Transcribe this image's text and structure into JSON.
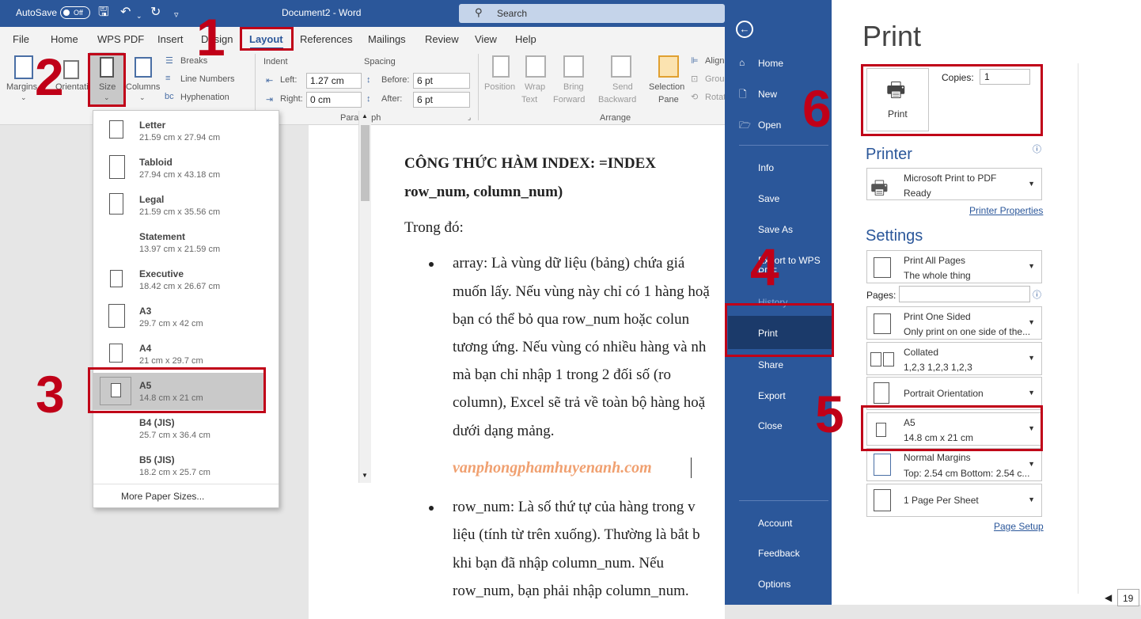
{
  "titlebar": {
    "autosave_label": "AutoSave",
    "autosave_state": "Off",
    "doc_title": "Document2 - Word",
    "search_placeholder": "Search"
  },
  "tabs": [
    "File",
    "Home",
    "WPS PDF",
    "Insert",
    "Design",
    "Layout",
    "References",
    "Mailings",
    "Review",
    "View",
    "Help"
  ],
  "ribbon": {
    "margins": "Margins",
    "orientation": "Orientation",
    "size": "Size",
    "columns": "Columns",
    "breaks": "Breaks",
    "line_numbers": "Line Numbers",
    "hyphenation": "Hyphenation",
    "indent_title": "Indent",
    "indent_left_label": "Left:",
    "indent_left_value": "1.27 cm",
    "indent_right_label": "Right:",
    "indent_right_value": "0 cm",
    "spacing_title": "Spacing",
    "spacing_before_label": "Before:",
    "spacing_before_value": "6 pt",
    "spacing_after_label": "After:",
    "spacing_after_value": "6 pt",
    "paragraph_group": "Paragraph",
    "position": "Position",
    "wrap_text_1": "Wrap",
    "wrap_text_2": "Text",
    "bring_forward_1": "Bring",
    "bring_forward_2": "Forward",
    "send_backward_1": "Send",
    "send_backward_2": "Backward",
    "selection_pane_1": "Selection",
    "selection_pane_2": "Pane",
    "align": "Align",
    "group": "Group",
    "rotate": "Rotate",
    "arrange_group": "Arrange"
  },
  "size_menu": {
    "items": [
      {
        "name": "Letter",
        "dims": "21.59 cm x 27.94 cm"
      },
      {
        "name": "Tabloid",
        "dims": "27.94 cm x 43.18 cm"
      },
      {
        "name": "Legal",
        "dims": "21.59 cm x 35.56 cm"
      },
      {
        "name": "Statement",
        "dims": "13.97 cm x 21.59 cm"
      },
      {
        "name": "Executive",
        "dims": "18.42 cm x 26.67 cm"
      },
      {
        "name": "A3",
        "dims": "29.7 cm x 42 cm"
      },
      {
        "name": "A4",
        "dims": "21 cm x 29.7 cm"
      },
      {
        "name": "A5",
        "dims": "14.8 cm x 21 cm"
      },
      {
        "name": "B4 (JIS)",
        "dims": "25.7 cm x 36.4 cm"
      },
      {
        "name": "B5 (JIS)",
        "dims": "18.2 cm x 25.7 cm"
      }
    ],
    "more": "More Paper Sizes..."
  },
  "document": {
    "heading_1": "CÔNG   THỨC   HÀM   INDEX:   =INDEX",
    "heading_2": "row_num, column_num)",
    "intro": "Trong đó:",
    "b1_l1": "array: Là vùng dữ liệu (bảng) chứa giá",
    "b1_l2": "muốn lấy. Nếu vùng này chỉ có 1 hàng hoặ",
    "b1_l3": "bạn có thể bỏ qua row_num hoặc colun",
    "b1_l4": "tương ứng. Nếu vùng có nhiều hàng và nh",
    "b1_l5": "mà bạn chỉ nhập 1 trong 2 đối số (ro",
    "b1_l6": "column), Excel sẽ trả về toàn bộ hàng hoặ",
    "b1_l7": "dưới dạng mảng.",
    "watermark": "vanphongphamhuyenanh.com",
    "b2_l1": "row_num: Là số thứ tự của hàng trong v",
    "b2_l2": "liệu (tính từ trên xuống). Thường là bắt b",
    "b2_l3": "khi   bạn   đã   nhập   column_num.   Nếu",
    "b2_l4": "row_num, bạn phải nhập column_num."
  },
  "backstage_nav": {
    "home": "Home",
    "new": "New",
    "open": "Open",
    "info": "Info",
    "save": "Save",
    "save_as": "Save As",
    "export_wps": "Export to WPS",
    "export_wps_2": "PDF",
    "history": "History",
    "print": "Print",
    "share": "Share",
    "export": "Export",
    "close": "Close",
    "account": "Account",
    "feedback": "Feedback",
    "options": "Options"
  },
  "print_panel": {
    "title": "Print",
    "print_button": "Print",
    "copies_label": "Copies:",
    "copies_value": "1",
    "printer_heading": "Printer",
    "printer_name": "Microsoft Print to PDF",
    "printer_status": "Ready",
    "printer_properties": "Printer Properties",
    "settings_heading": "Settings",
    "print_all_1": "Print All Pages",
    "print_all_2": "The whole thing",
    "pages_label": "Pages:",
    "one_sided_1": "Print One Sided",
    "one_sided_2": "Only print on one side of the...",
    "collated_1": "Collated",
    "collated_2": "1,2,3    1,2,3    1,2,3",
    "orientation": "Portrait Orientation",
    "paper_1": "A5",
    "paper_2": "14.8 cm x 21 cm",
    "margins_1": "Normal Margins",
    "margins_2": "Top: 2.54 cm Bottom: 2.54 c...",
    "per_sheet": "1 Page Per Sheet",
    "page_setup": "Page Setup",
    "page_number": "19"
  },
  "annotations": {
    "n1": "1",
    "n2": "2",
    "n3": "3",
    "n4": "4",
    "n5": "5",
    "n6": "6"
  },
  "colors": {
    "word_blue": "#2b579a",
    "annotation_red": "#c00018",
    "watermark_orange": "#f0a070"
  }
}
